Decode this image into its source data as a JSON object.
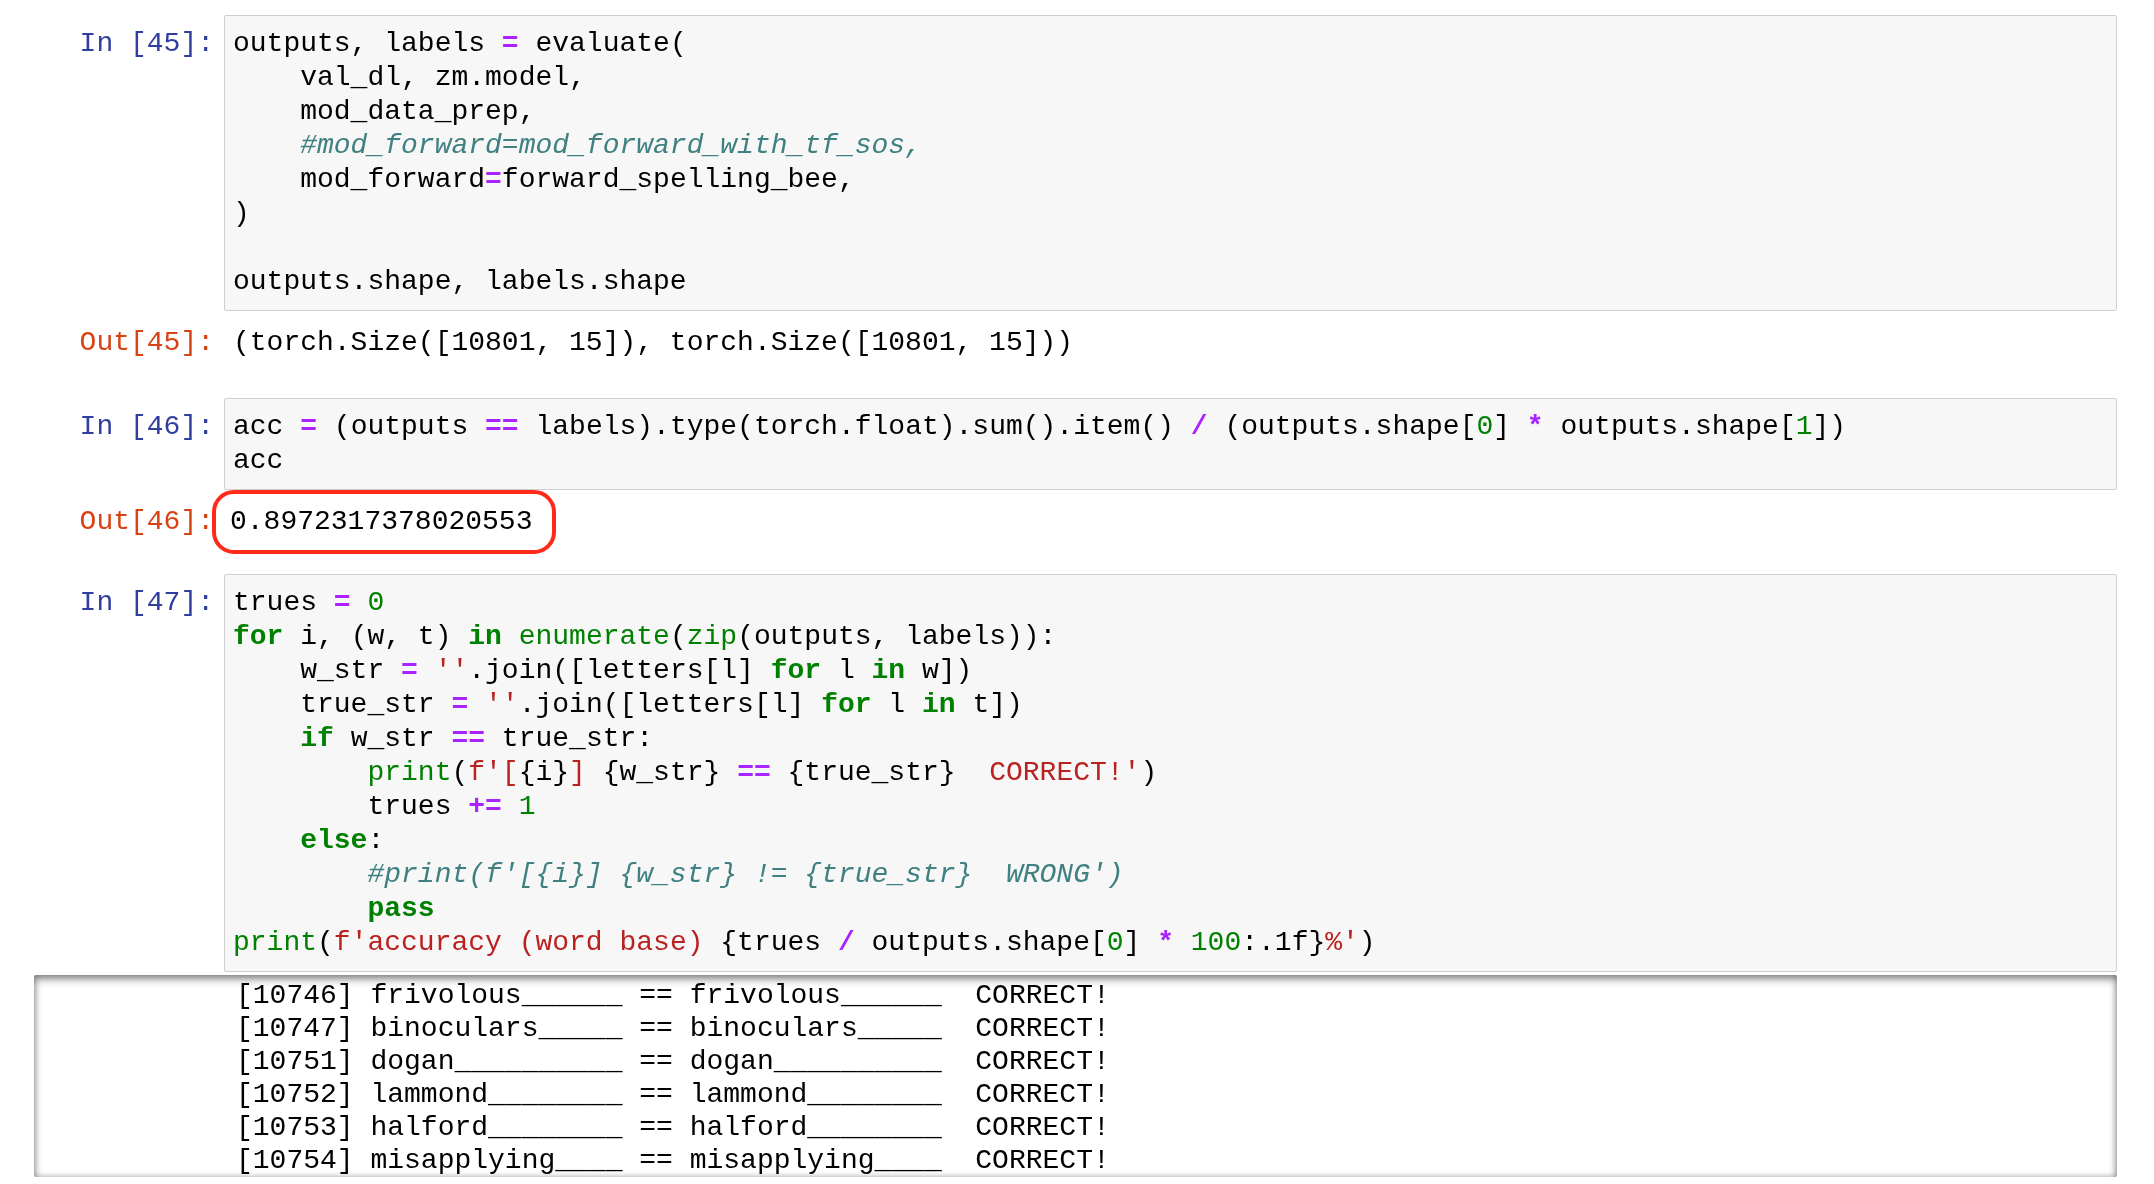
{
  "cells": [
    {
      "prompt": "In [45]:",
      "lines": [
        {
          "tokens": [
            {
              "text": "outputs, labels "
            },
            {
              "text": "=",
              "kind": "op"
            },
            {
              "text": " evaluate("
            }
          ]
        },
        {
          "tokens": [
            {
              "text": "    val_dl, zm.model,"
            }
          ]
        },
        {
          "tokens": [
            {
              "text": "    mod_data_prep,"
            }
          ]
        },
        {
          "tokens": [
            {
              "text": "    #mod_forward=mod_forward_with_tf_sos,",
              "kind": "cm"
            }
          ]
        },
        {
          "tokens": [
            {
              "text": "    mod_forward"
            },
            {
              "text": "=",
              "kind": "op"
            },
            {
              "text": "forward_spelling_bee,"
            }
          ]
        },
        {
          "tokens": [
            {
              "text": ")"
            }
          ]
        },
        {
          "space_before": true,
          "tokens": [
            {
              "text": "outputs.shape, labels.shape"
            }
          ]
        }
      ],
      "output": {
        "prompt": "Out[45]:",
        "text": "(torch.Size([10801, 15]), torch.Size([10801, 15]))",
        "highlighted": false
      }
    },
    {
      "prompt": "In [46]:",
      "lines": [
        {
          "tokens": [
            {
              "text": "acc "
            },
            {
              "text": "=",
              "kind": "op"
            },
            {
              "text": " (outputs "
            },
            {
              "text": "==",
              "kind": "op"
            },
            {
              "text": " labels).type(torch.float).sum().item() "
            },
            {
              "text": "/",
              "kind": "op"
            },
            {
              "text": " (outputs.shape["
            },
            {
              "text": "0",
              "kind": "num"
            },
            {
              "text": "] "
            },
            {
              "text": "*",
              "kind": "op"
            },
            {
              "text": " outputs.shape["
            },
            {
              "text": "1",
              "kind": "num"
            },
            {
              "text": "])"
            }
          ]
        },
        {
          "tokens": [
            {
              "text": "acc"
            }
          ]
        }
      ],
      "output": {
        "prompt": "Out[46]:",
        "text": "0.8972317378020553",
        "highlighted": true
      }
    },
    {
      "prompt": "In [47]:",
      "lines": [
        {
          "tokens": [
            {
              "text": "trues "
            },
            {
              "text": "=",
              "kind": "op"
            },
            {
              "text": " 0",
              "kind": "num"
            }
          ]
        },
        {
          "tokens": [
            {
              "text": "for",
              "kind": "kw"
            },
            {
              "text": " i, (w, t) "
            },
            {
              "text": "in",
              "kind": "kw"
            },
            {
              "text": " enumerate",
              "kind": "bi"
            },
            {
              "text": "("
            },
            {
              "text": "zip",
              "kind": "bi"
            },
            {
              "text": "(outputs, labels)):"
            }
          ]
        },
        {
          "tokens": [
            {
              "text": "    w_str "
            },
            {
              "text": "=",
              "kind": "op"
            },
            {
              "text": " ''",
              "kind": "st"
            },
            {
              "text": ".join([letters[l] "
            },
            {
              "text": "for",
              "kind": "kw"
            },
            {
              "text": " l "
            },
            {
              "text": "in",
              "kind": "kw"
            },
            {
              "text": " w])"
            }
          ]
        },
        {
          "tokens": [
            {
              "text": "    true_str "
            },
            {
              "text": "=",
              "kind": "op"
            },
            {
              "text": " ''",
              "kind": "st"
            },
            {
              "text": ".join([letters[l] "
            },
            {
              "text": "for",
              "kind": "kw"
            },
            {
              "text": " l "
            },
            {
              "text": "in",
              "kind": "kw"
            },
            {
              "text": " t])"
            }
          ]
        },
        {
          "tokens": [
            {
              "text": "    if",
              "kind": "kw"
            },
            {
              "text": " w_str "
            },
            {
              "text": "==",
              "kind": "op"
            },
            {
              "text": " true_str:"
            }
          ]
        },
        {
          "tokens": [
            {
              "text": "        print",
              "kind": "bi"
            },
            {
              "text": "("
            },
            {
              "text": "f'[",
              "kind": "st"
            },
            {
              "text": "{i}"
            },
            {
              "text": "]",
              "kind": "st"
            },
            {
              "text": " {w_str} "
            },
            {
              "text": "==",
              "kind": "op"
            },
            {
              "text": " {true_str}"
            },
            {
              "text": "  CORRECT!'",
              "kind": "st"
            },
            {
              "text": ")"
            }
          ]
        },
        {
          "tokens": [
            {
              "text": "        trues "
            },
            {
              "text": "+=",
              "kind": "op"
            },
            {
              "text": " 1",
              "kind": "num"
            }
          ]
        },
        {
          "tokens": [
            {
              "text": "    else",
              "kind": "kw"
            },
            {
              "text": ":"
            }
          ]
        },
        {
          "tokens": [
            {
              "text": "        #print(f'[{i}] {w_str} != {true_str}  WRONG')",
              "kind": "cm"
            }
          ]
        },
        {
          "tokens": [
            {
              "text": "        pass",
              "kind": "kw"
            }
          ]
        },
        {
          "tokens": [
            {
              "text": "print",
              "kind": "bi"
            },
            {
              "text": "("
            },
            {
              "text": "f'accuracy (word base) ",
              "kind": "st"
            },
            {
              "text": "{trues "
            },
            {
              "text": "/",
              "kind": "op"
            },
            {
              "text": " outputs.shape["
            },
            {
              "text": "0",
              "kind": "num"
            },
            {
              "text": "] "
            },
            {
              "text": "*",
              "kind": "op"
            },
            {
              "text": " 100",
              "kind": "num"
            },
            {
              "text": ":.1f}"
            },
            {
              "text": "%'",
              "kind": "st"
            },
            {
              "text": ")"
            }
          ]
        }
      ],
      "stream": [
        "[10746] frivolous______ == frivolous______  CORRECT!",
        "[10747] binoculars_____ == binoculars_____  CORRECT!",
        "[10751] dogan__________ == dogan__________  CORRECT!",
        "[10752] lammond________ == lammond________  CORRECT!",
        "[10753] halford________ == halford________  CORRECT!",
        "[10754] misapplying____ == misapplying____  CORRECT!"
      ]
    }
  ]
}
